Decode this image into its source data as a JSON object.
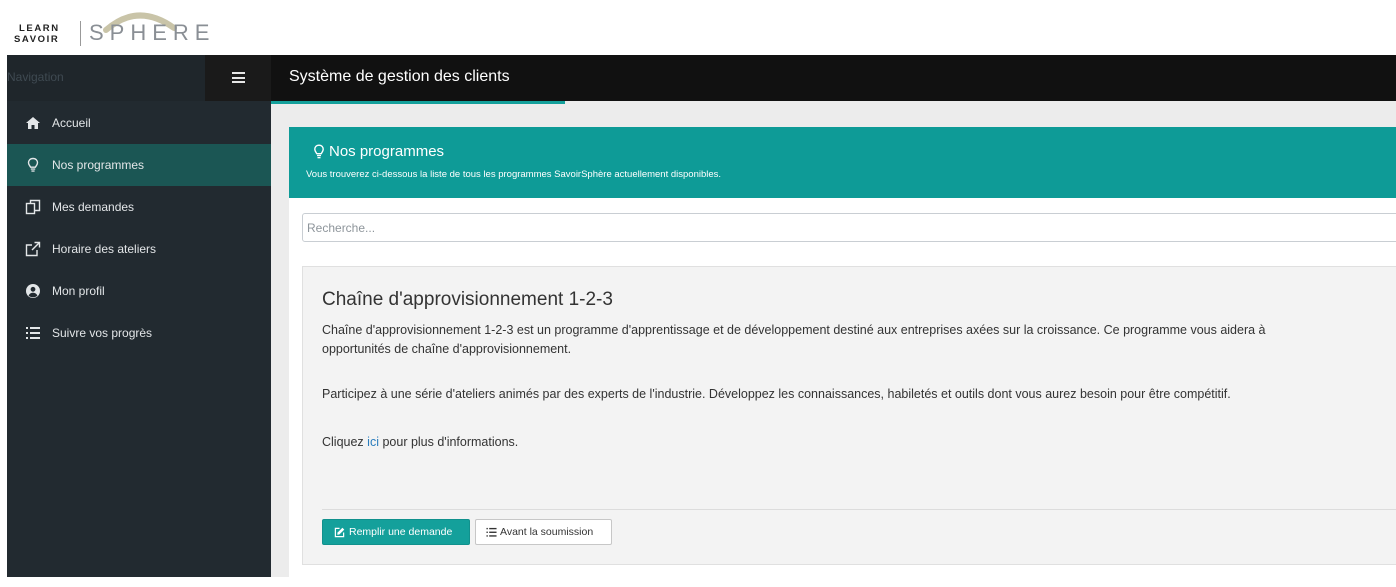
{
  "logo": {
    "line1": "LEARN",
    "line2": "SAVOIR",
    "wordmark": "SPHERE"
  },
  "sidebar": {
    "heading": "Navigation",
    "menu_icon": "hamburger-icon",
    "active_color": "#1b5654",
    "items": [
      {
        "label": "Accueil",
        "icon": "home-icon"
      },
      {
        "label": "Nos programmes",
        "icon": "lightbulb-icon"
      },
      {
        "label": "Mes demandes",
        "icon": "copy-icon"
      },
      {
        "label": "Horaire des ateliers",
        "icon": "external-link-icon"
      },
      {
        "label": "Mon profil",
        "icon": "user-circle-icon"
      },
      {
        "label": "Suivre vos progrès",
        "icon": "list-icon"
      }
    ],
    "active_item": "Nos programmes"
  },
  "header": {
    "title": "Système de gestion des clients"
  },
  "panel": {
    "title": "Nos programmes",
    "subtitle": "Vous trouverez ci-dessous la liste de tous les programmes SavoirSphère actuellement disponibles.",
    "icon": "lightbulb-icon",
    "accent": "#0e9b97"
  },
  "search": {
    "placeholder": "Recherche...",
    "value": ""
  },
  "program": {
    "title": "Chaîne d'approvisionnement 1-2-3",
    "description_line1": "Chaîne d'approvisionnement 1-2-3 est un programme d'apprentissage et de développement destiné aux entreprises axées sur la croissance. Ce programme vous aidera à",
    "description_line2": "opportunités de chaîne d'approvisionnement.",
    "paragraph2": "Participez à une série d'ateliers animés par des experts de l'industrie. Développez les connaissances, habiletés et outils dont vous aurez besoin pour être compétitif.",
    "info_prefix": "Cliquez ",
    "info_link": "ici",
    "info_suffix": " pour plus d'informations.",
    "primary_button": "Remplir une demande",
    "primary_icon": "edit-icon",
    "secondary_button": "Avant la soumission",
    "secondary_icon": "list-icon"
  }
}
